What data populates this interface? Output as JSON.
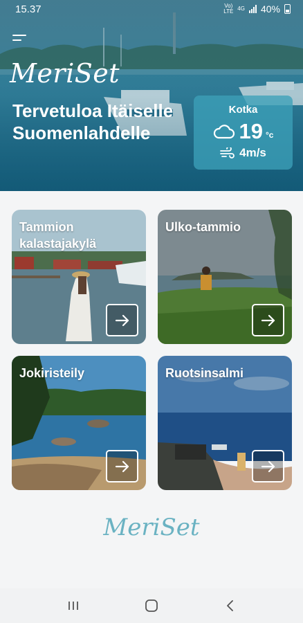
{
  "status_bar": {
    "time": "15.37",
    "network_tag_top": "Vo)",
    "network_tag_bottom": "LTE",
    "data_tag": "4G",
    "battery": "40%",
    "icons": [
      "signal-icon",
      "battery-icon"
    ]
  },
  "hero": {
    "logo": "MeriSet",
    "title": "Tervetuloa Itäiselle Suomenlahdelle",
    "menu_icon": "hamburger-menu-icon"
  },
  "weather": {
    "location": "Kotka",
    "temperature": "19",
    "unit": "°c",
    "wind": "4m/s",
    "icons": [
      "cloud-icon",
      "wind-icon"
    ]
  },
  "destinations": [
    {
      "title": "Tammion kalastajakylä",
      "icon": "arrow-right-icon"
    },
    {
      "title": "Ulko-tammio",
      "icon": "arrow-right-icon"
    },
    {
      "title": "Jokiristeily",
      "icon": "arrow-right-icon"
    },
    {
      "title": "Ruotsinsalmi",
      "icon": "arrow-right-icon"
    }
  ],
  "footer": {
    "logo": "MeriSet"
  },
  "nav_bar": {
    "icons": [
      "recent-apps-icon",
      "home-icon",
      "back-icon"
    ]
  },
  "colors": {
    "hero_teal": "#1f6a86",
    "weather_card": "#3ca0b9",
    "footer_logo": "#6ab2c2",
    "background": "#f4f5f6"
  }
}
